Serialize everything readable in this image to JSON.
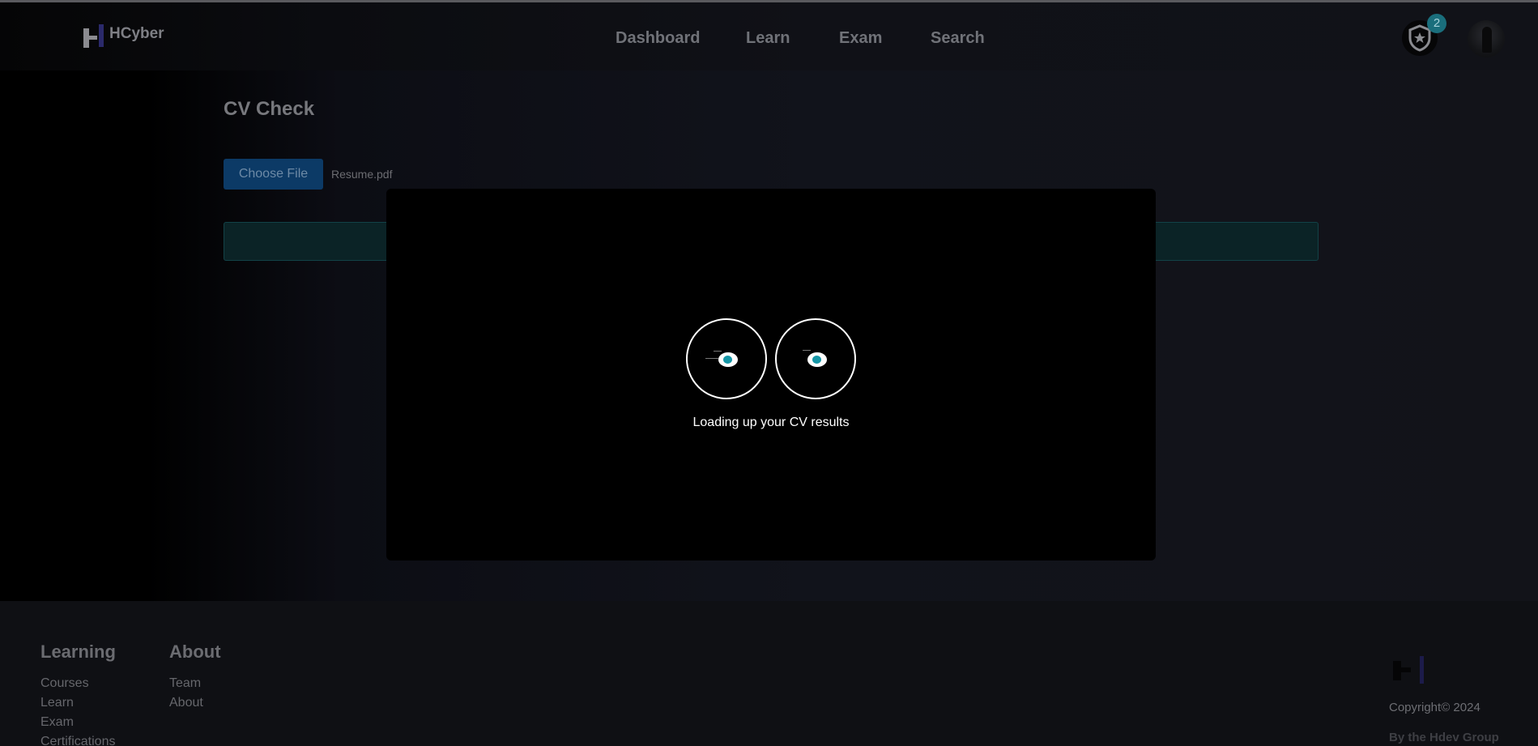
{
  "brand": {
    "name": "HCyber"
  },
  "nav": {
    "links": [
      "Dashboard",
      "Learn",
      "Exam",
      "Search"
    ],
    "badge_count": "2",
    "badge_icon": "shield-star-icon"
  },
  "main": {
    "title": "CV Check",
    "choose_file_label": "Choose File",
    "file_name": "Resume.pdf"
  },
  "modal": {
    "loading_text": "Loading up your CV results"
  },
  "footer": {
    "learning": {
      "heading": "Learning",
      "links": [
        "Courses",
        "Learn",
        "Exam",
        "Certifications"
      ]
    },
    "about": {
      "heading": "About",
      "links": [
        "Team",
        "About"
      ]
    },
    "copyright": "Copyright© 2024",
    "byline": "By the Hdev Group"
  },
  "colors": {
    "accent": "#1596a6",
    "button": "#0c3a66",
    "badge": "#1a6e7c"
  }
}
